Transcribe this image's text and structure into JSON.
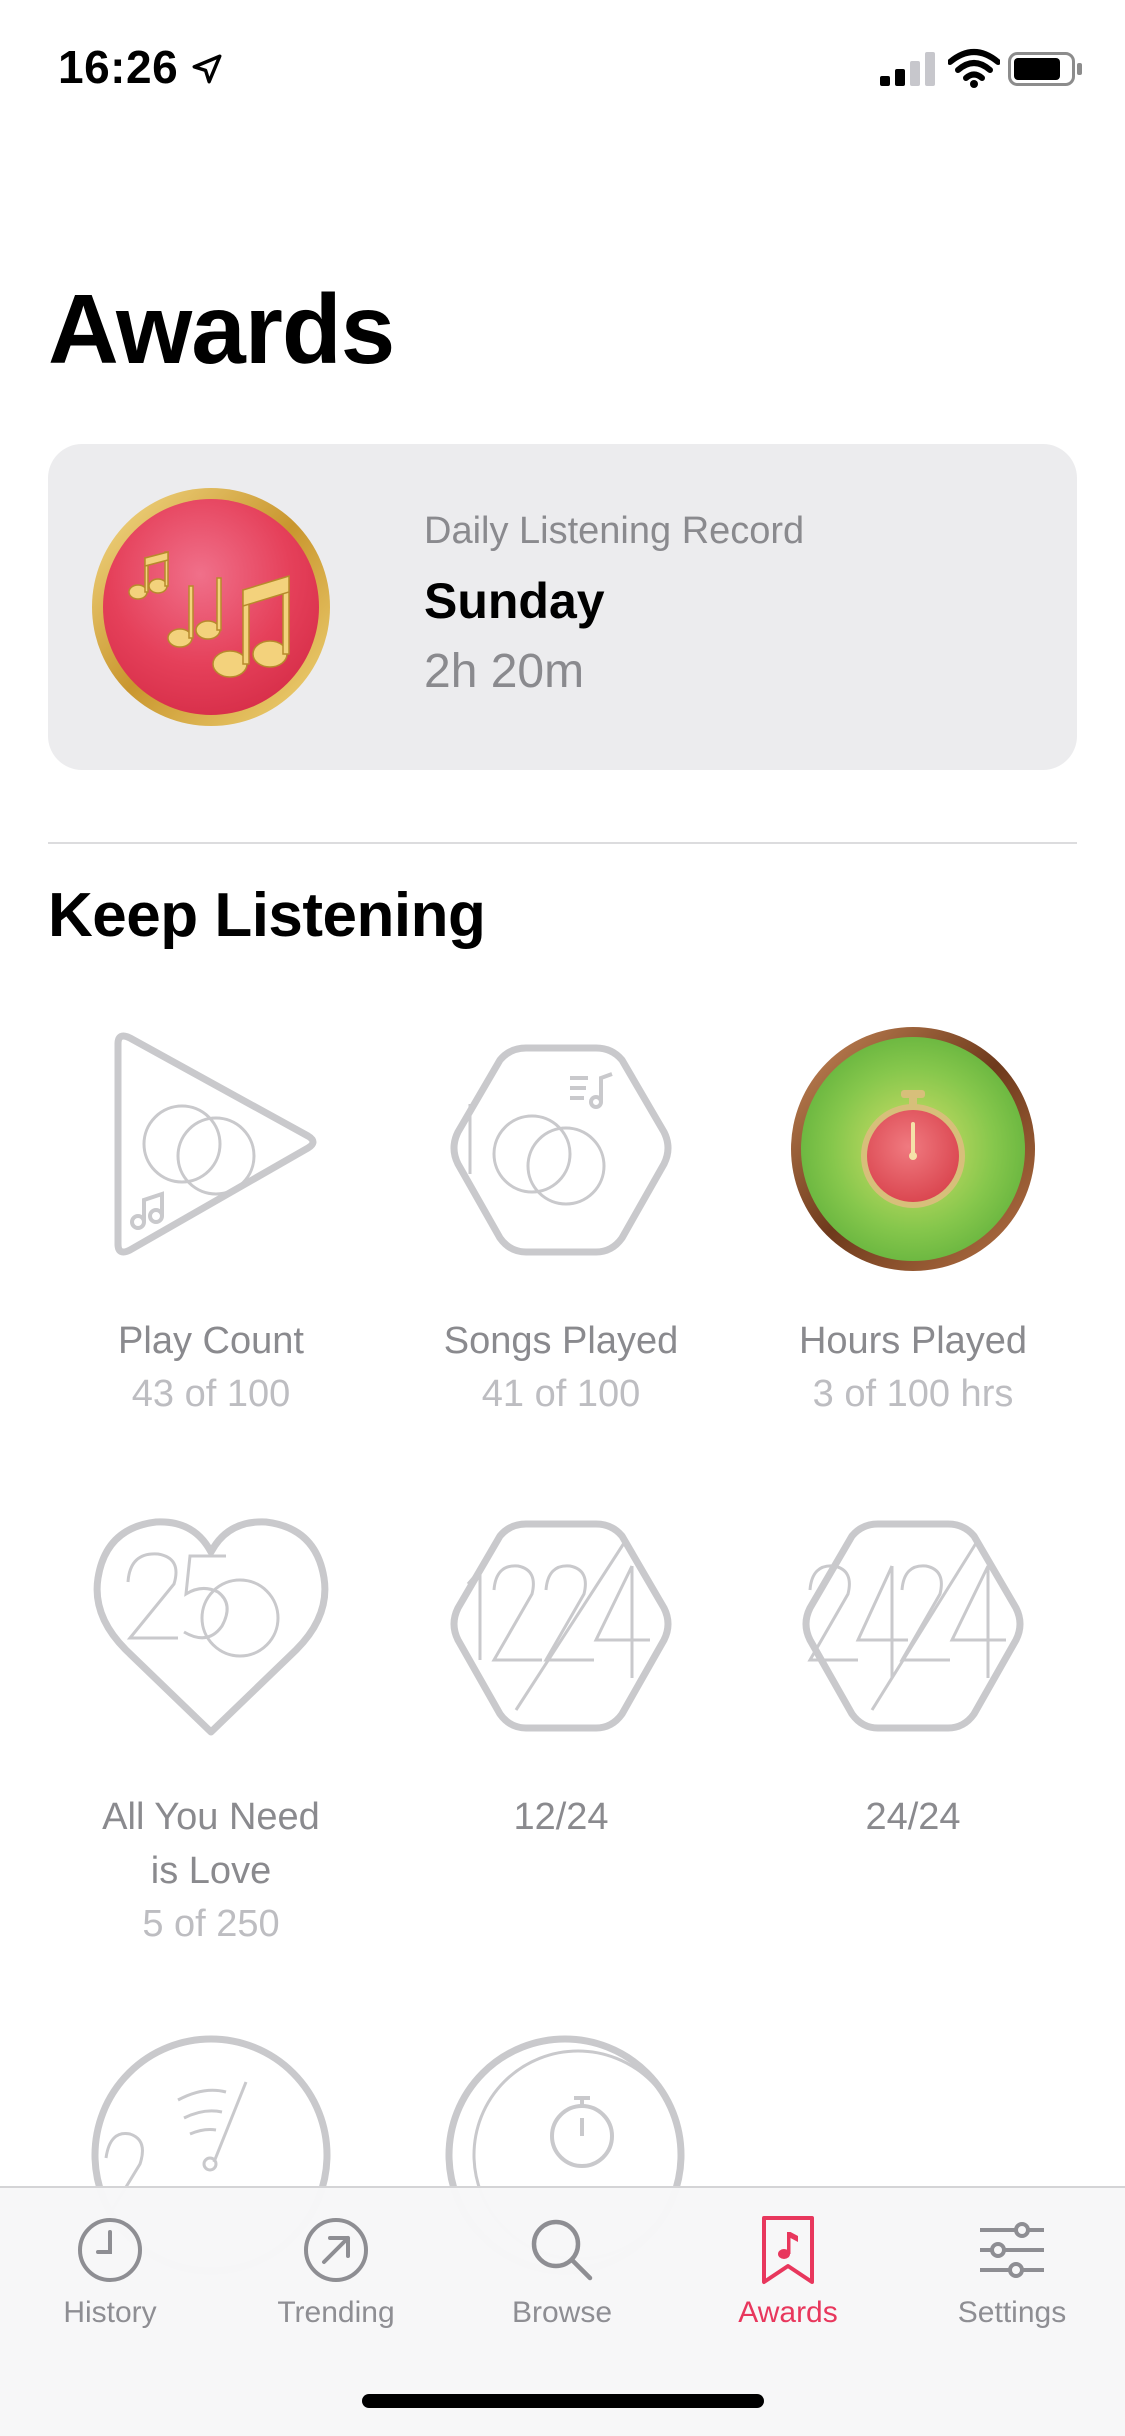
{
  "status_bar": {
    "time": "16:26",
    "icons": [
      "location-arrow-icon",
      "cellular-signal-icon",
      "wifi-icon",
      "battery-icon"
    ]
  },
  "page": {
    "title": "Awards"
  },
  "record_card": {
    "kicker": "Daily Listening Record",
    "day": "Sunday",
    "value": "2h 20m",
    "medal_icon": "music-notes-medal-icon"
  },
  "section": {
    "title": "Keep Listening"
  },
  "awards": [
    {
      "label": "Play Count",
      "progress": "43 of 100",
      "icon": "play-count-badge-icon"
    },
    {
      "label": "Songs Played",
      "progress": "41 of 100",
      "icon": "songs-played-badge-icon"
    },
    {
      "label": "Hours Played",
      "progress": "3 of 100 hrs",
      "icon": "hours-played-medal-icon"
    },
    {
      "label": "All You Need",
      "label_line2": "is Love",
      "progress": "5 of 250",
      "icon": "heart-250-badge-icon"
    },
    {
      "label": "12/24",
      "icon": "12-24-badge-icon"
    },
    {
      "label": "24/24",
      "icon": "24-24-badge-icon"
    }
  ],
  "tabs": [
    {
      "label": "History",
      "icon": "clock-icon",
      "active": false
    },
    {
      "label": "Trending",
      "icon": "trending-arrow-icon",
      "active": false
    },
    {
      "label": "Browse",
      "icon": "search-icon",
      "active": false
    },
    {
      "label": "Awards",
      "icon": "bookmark-music-icon",
      "active": true
    },
    {
      "label": "Settings",
      "icon": "sliders-icon",
      "active": false
    }
  ],
  "colors": {
    "accent": "#e8375d",
    "medal_red": "#e84a5f",
    "medal_green": "#7fc24a",
    "gold": "#d9b24a",
    "bronze": "#8a4e2a",
    "badge_outline": "#c9c9cc"
  }
}
